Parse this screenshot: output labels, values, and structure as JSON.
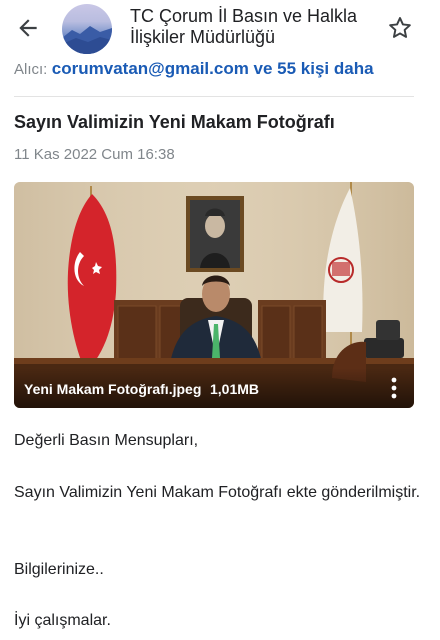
{
  "header": {
    "sender_name": "TC Çorum İl Basın ve Halkla İlişkiler Müdürlüğü",
    "back_icon": "arrow-left-icon",
    "star_icon": "star-outline-icon"
  },
  "recipients": {
    "label": "Alıcı:",
    "value": "corumvatan@gmail.com ve 55 kişi daha"
  },
  "message": {
    "subject": "Sayın Valimizin Yeni Makam Fotoğrafı",
    "date": "11 Kas 2022 Cum 16:38",
    "body": [
      "Değerli Basın Mensupları,",
      "Sayın Valimizin Yeni Makam Fotoğrafı ekte gönderilmiştir.",
      "Bilgilerinize..",
      "İyi çalışmalar."
    ]
  },
  "attachment": {
    "file_name": "Yeni Makam Fotoğrafı.jpeg",
    "file_size": "1,01MB",
    "menu_icon": "more-vertical-icon"
  },
  "colors": {
    "link_blue": "#1a5bb5",
    "muted_gray": "#80868b",
    "text": "#202124"
  }
}
